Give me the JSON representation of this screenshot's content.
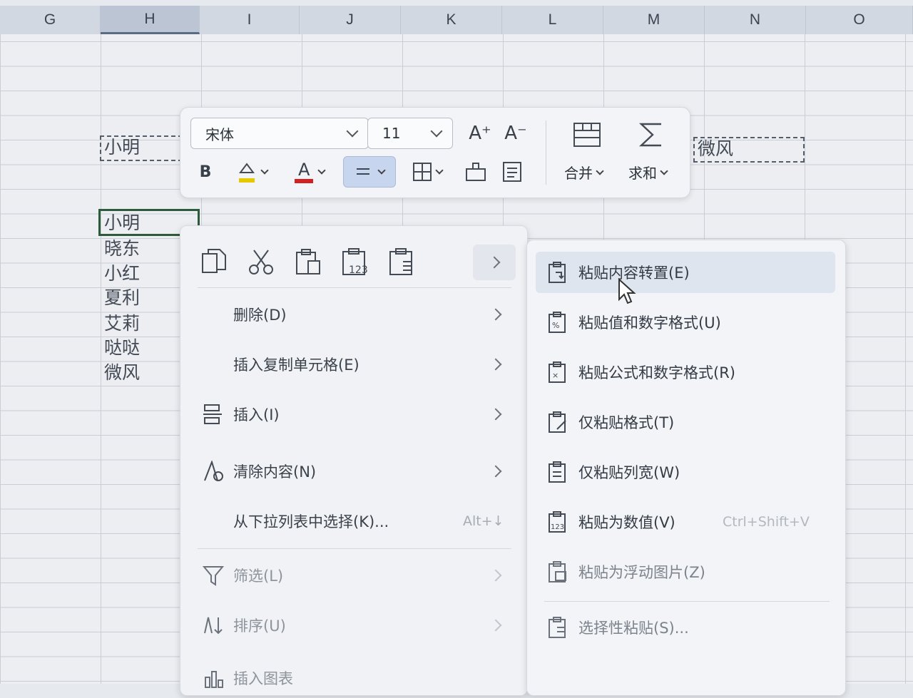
{
  "columns": [
    "G",
    "H",
    "I",
    "J",
    "K",
    "L",
    "M",
    "N",
    "O"
  ],
  "cells": {
    "h_copied": "小明",
    "n_copied": "微风",
    "h_list": [
      "小明",
      "晓东",
      "小红",
      "夏利",
      "艾莉",
      "哒哒",
      "微风"
    ]
  },
  "toolbar": {
    "font_name": "宋体",
    "font_size": "11",
    "grow_font": "A⁺",
    "shrink_font": "A⁻",
    "bold": "B",
    "font_color_glyph": "A",
    "merge_label": "合并",
    "sum_label": "求和"
  },
  "context_menu": {
    "items": [
      {
        "label": "删除(D)",
        "icon": "none",
        "arrow": true
      },
      {
        "label": "插入复制单元格(E)",
        "icon": "none",
        "arrow": true
      },
      {
        "label": "插入(I)",
        "icon": "insert-icon",
        "arrow": true
      },
      {
        "label": "清除内容(N)",
        "icon": "clear-icon",
        "arrow": true
      },
      {
        "label": "从下拉列表中选择(K)...",
        "icon": "none",
        "shortcut": "Alt+↓"
      },
      {
        "label": "筛选(L)",
        "icon": "filter-icon",
        "arrow": true
      },
      {
        "label": "排序(U)",
        "icon": "sort-icon",
        "arrow": true
      },
      {
        "label": "插入图表",
        "icon": "chart-icon"
      }
    ]
  },
  "paste_submenu": {
    "items": [
      {
        "label": "粘贴内容转置(E)"
      },
      {
        "label": "粘贴值和数字格式(U)"
      },
      {
        "label": "粘贴公式和数字格式(R)"
      },
      {
        "label": "仅粘贴格式(T)"
      },
      {
        "label": "仅粘贴列宽(W)"
      },
      {
        "label": "粘贴为数值(V)",
        "shortcut": "Ctrl+Shift+V"
      },
      {
        "label": "粘贴为浮动图片(Z)"
      },
      {
        "label": "选择性粘贴(S)..."
      }
    ]
  }
}
